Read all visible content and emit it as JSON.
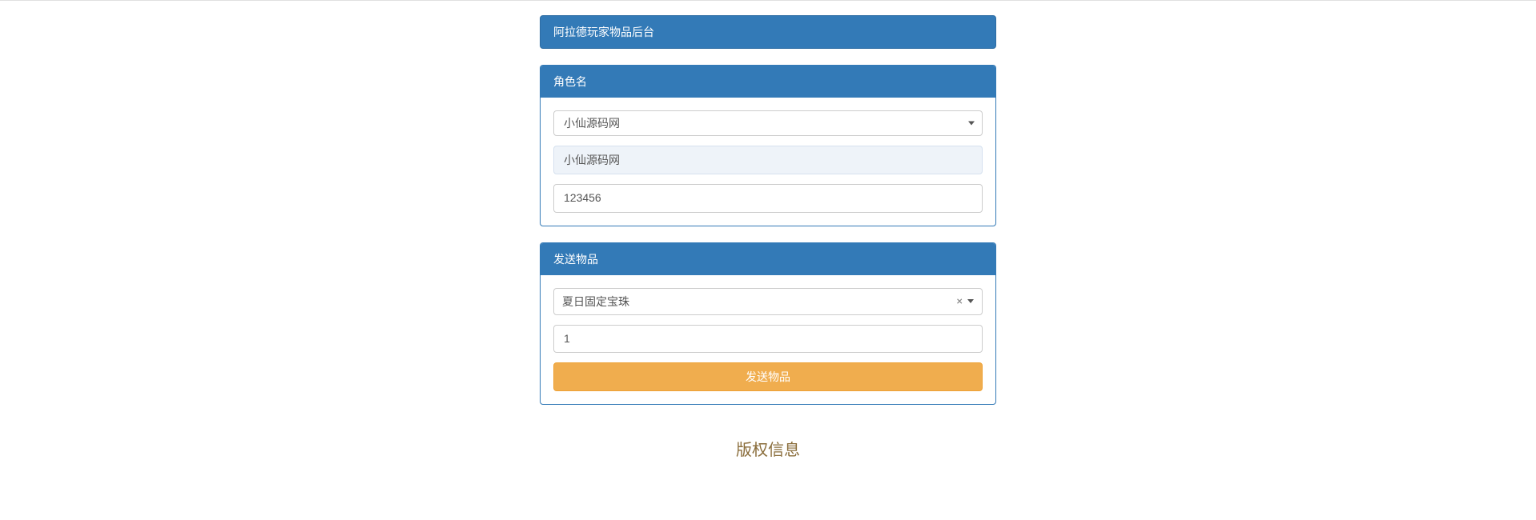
{
  "banner": {
    "title": "阿拉德玩家物品后台"
  },
  "characterPanel": {
    "header": "角色名",
    "selectedOption": "小仙源码网",
    "readonlyName": "小仙源码网",
    "idValue": "123456"
  },
  "sendPanel": {
    "header": "发送物品",
    "itemSelected": "夏日固定宝珠",
    "clearSymbol": "×",
    "quantity": "1",
    "buttonLabel": "发送物品"
  },
  "footer": {
    "copyright": "版权信息"
  }
}
